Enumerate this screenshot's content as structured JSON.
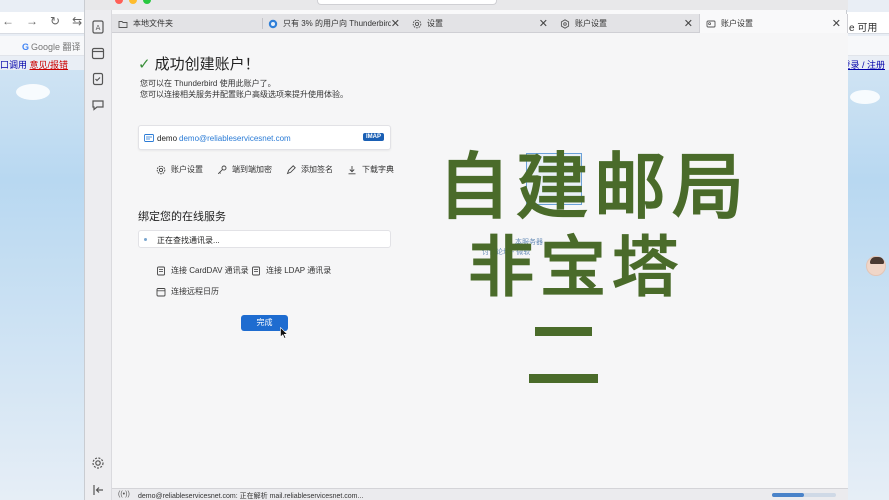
{
  "background_browser": {
    "translate_label": "Google 翻译",
    "left_link_prefix": "口调用",
    "left_link": "意见/报错",
    "right_link": "登录 / 注册",
    "right_fragment": "e 可用"
  },
  "tabs": [
    {
      "label": "本地文件夹",
      "icon": "folder-icon"
    },
    {
      "label": "只有 3% 的用户向 Thunderbird 提供...",
      "icon": "thunderbird-icon"
    },
    {
      "label": "设置",
      "icon": "gear-icon"
    },
    {
      "label": "账户设置",
      "icon": "settings-icon"
    },
    {
      "label": "账户设置",
      "icon": "account-settings-icon",
      "active": true
    }
  ],
  "success": {
    "title": "成功创建账户！",
    "desc1": "您可以在 Thunderbird 使用此账户了。",
    "desc2": "您可以连接相关服务并配置账户高级选项来提升使用体验。"
  },
  "account": {
    "name": "demo",
    "email": "demo@reliableservicesnet.com",
    "protocol": "IMAP"
  },
  "actions": [
    {
      "label": "账户设置",
      "icon": "gear-icon"
    },
    {
      "label": "端到端加密",
      "icon": "key-icon"
    },
    {
      "label": "添加签名",
      "icon": "pen-icon"
    },
    {
      "label": "下载字典",
      "icon": "download-icon"
    }
  ],
  "services": {
    "title": "绑定您的在线服务",
    "status": "正在查找通讯录...",
    "carddav": "连接 CardDAV 通讯录",
    "ldap": "连接 LDAP 通讯录",
    "calendar": "连接远程日历"
  },
  "done_button": "完成",
  "statusbar": {
    "text": "demo@reliableservicesnet.com: 正在解析 mail.reliableservicesnet.com...",
    "progress": 0.5
  },
  "ghost": {
    "line1": "本服务器",
    "line2": "讨论论坛 - 微软"
  },
  "overlay": {
    "line1": "自建邮局",
    "line2": "非宝塔",
    "color": "#4a6b2a"
  }
}
